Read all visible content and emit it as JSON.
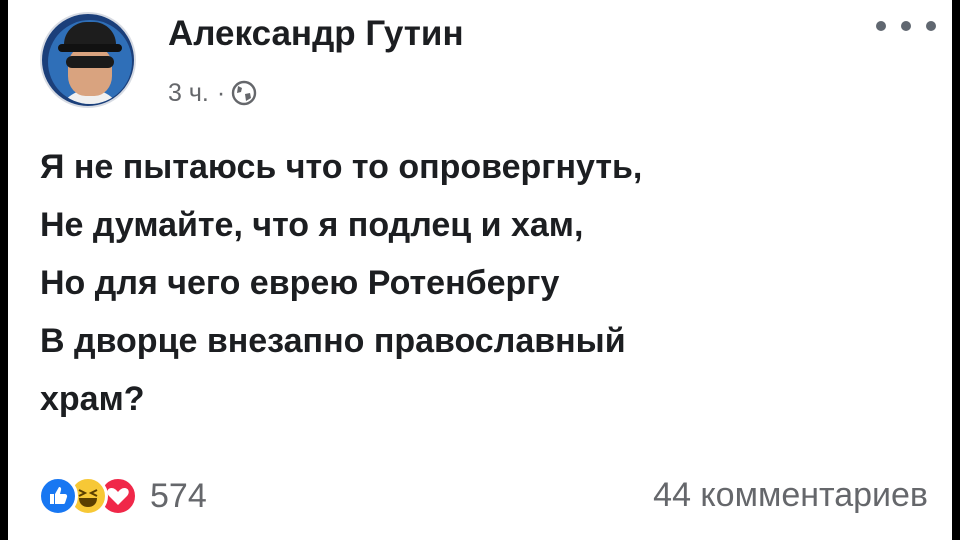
{
  "post": {
    "author_name": "Александр Гутин",
    "time": "3 ч.",
    "separator": "·",
    "audience_icon": "globe-icon",
    "more_icon": "more-options-icon",
    "text_lines": [
      "Я не пытаюсь что то опровергнуть,",
      "Не думайте, что я подлец и хам,",
      "Но для чего еврею Ротенбергу",
      "В дворце внезапно православный",
      "храм?"
    ]
  },
  "footer": {
    "reactions": [
      "like",
      "haha",
      "love"
    ],
    "reaction_count": "574",
    "comments_label": "44 комментариев"
  },
  "colors": {
    "like": "#1877f2",
    "haha": "#f7c836",
    "love": "#f02849",
    "text": "#1c1e21",
    "secondary": "#65676b"
  }
}
